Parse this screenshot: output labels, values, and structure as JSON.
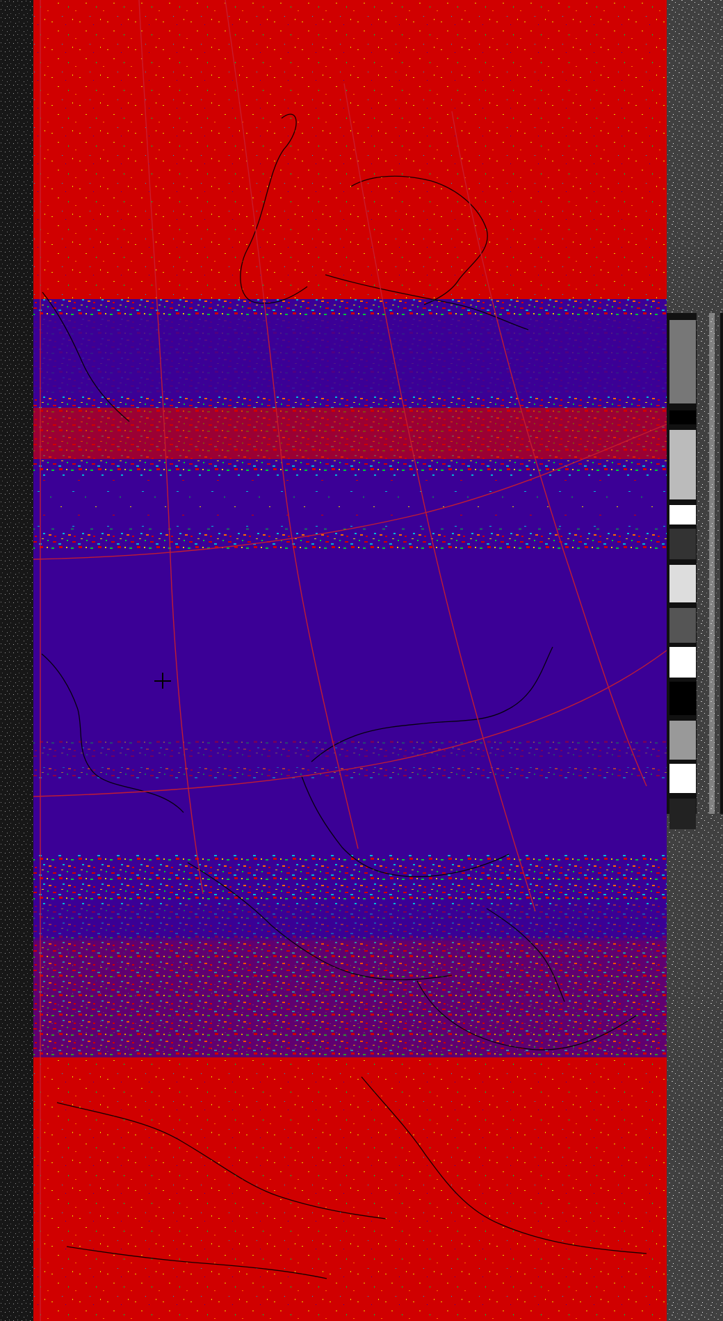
{
  "image": {
    "kind": "satellite weather image (colorized APT/NOAA style)",
    "dimensions": {
      "width": 1040,
      "height": 1899
    }
  },
  "palette": {
    "red": "#d00000",
    "purple": "#3b0096",
    "yellow": "#e6d200",
    "green": "#00c63c",
    "cyan": "#00b8d8",
    "orange": "#ff6a00",
    "black": "#000000",
    "grid_line": "#c81e2f",
    "coast_line": "#000000",
    "left_strip_dark": "#111111",
    "right_strip_mid": "#707070",
    "right_strip_light": "#ffffff"
  },
  "icons": {
    "crosshair": "crosshair-plus-icon"
  }
}
